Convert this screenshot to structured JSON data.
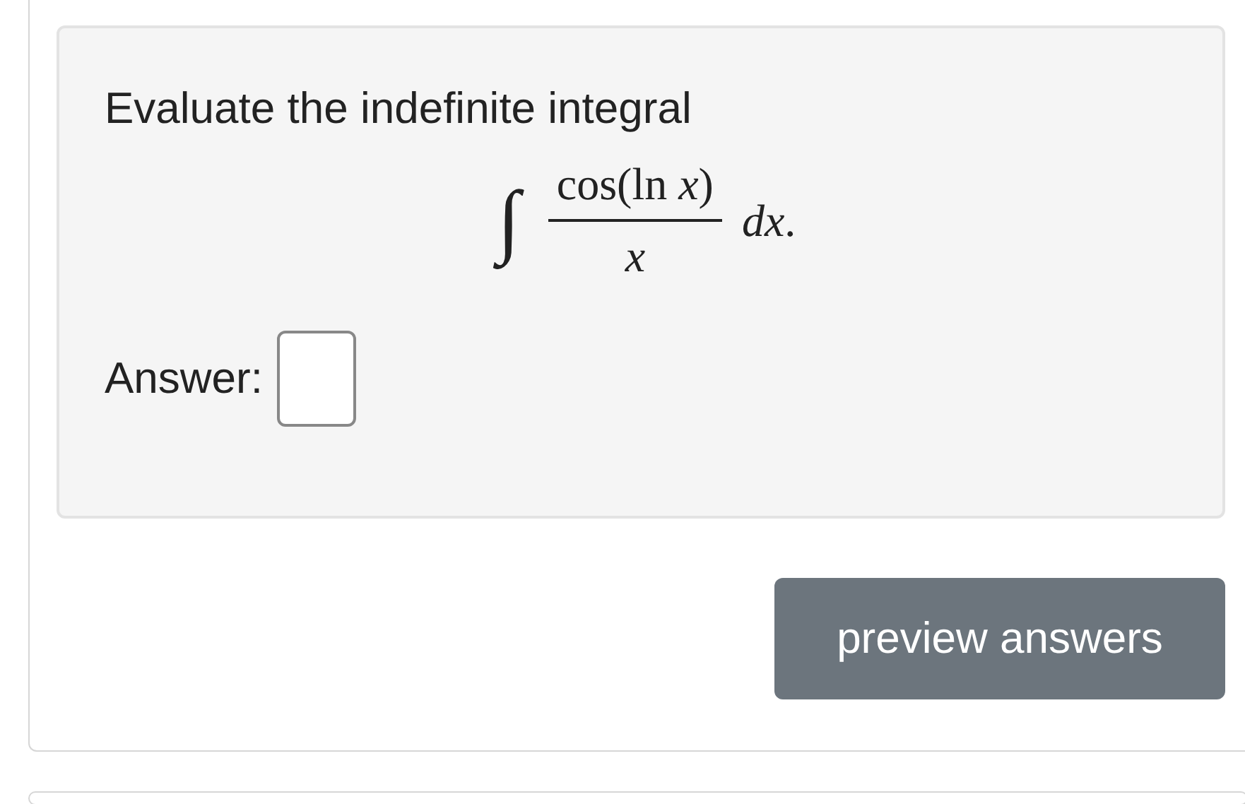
{
  "question": {
    "prompt": "Evaluate the indefinite integral",
    "integral": {
      "sign": "∫",
      "numerator": "cos(ln *x*)",
      "denominator": "x",
      "differential": "*dx*."
    },
    "answer": {
      "label": "Answer:"
    }
  },
  "buttons": [
    {
      "label": "preview answers"
    }
  ]
}
